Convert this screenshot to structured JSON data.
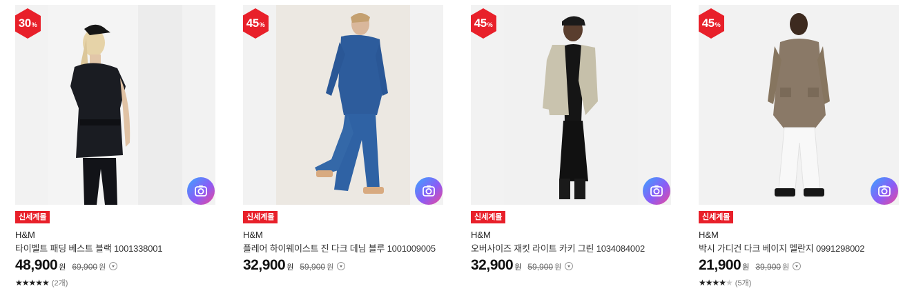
{
  "colors": {
    "sale_badge": "#e8202a",
    "tag": "#e8202a",
    "background": "#ffffff"
  },
  "products": [
    {
      "discount": "30",
      "discount_unit": "%",
      "tag": "신세계몰",
      "brand": "H&M",
      "name": "타이벨트 패딩 베스트 블랙 1001338001",
      "price": "48,900",
      "price_unit": "원",
      "original_price": "69,900",
      "original_unit": "원",
      "rating_stars": 5,
      "review_count": "(2개)"
    },
    {
      "discount": "45",
      "discount_unit": "%",
      "tag": "신세계몰",
      "brand": "H&M",
      "name": "플레어 하이웨이스트 진 다크 데님 블루 1001009005",
      "price": "32,900",
      "price_unit": "원",
      "original_price": "59,900",
      "original_unit": "원"
    },
    {
      "discount": "45",
      "discount_unit": "%",
      "tag": "신세계몰",
      "brand": "H&M",
      "name": "오버사이즈 재킷 라이트 카키 그린 1034084002",
      "price": "32,900",
      "price_unit": "원",
      "original_price": "59,900",
      "original_unit": "원"
    },
    {
      "discount": "45",
      "discount_unit": "%",
      "tag": "신세계몰",
      "brand": "H&M",
      "name": "박시 가디건 다크 베이지 멜란지 0991298002",
      "price": "21,900",
      "price_unit": "원",
      "original_price": "39,900",
      "original_unit": "원",
      "rating_stars": 4,
      "review_count": "(5개)"
    }
  ]
}
